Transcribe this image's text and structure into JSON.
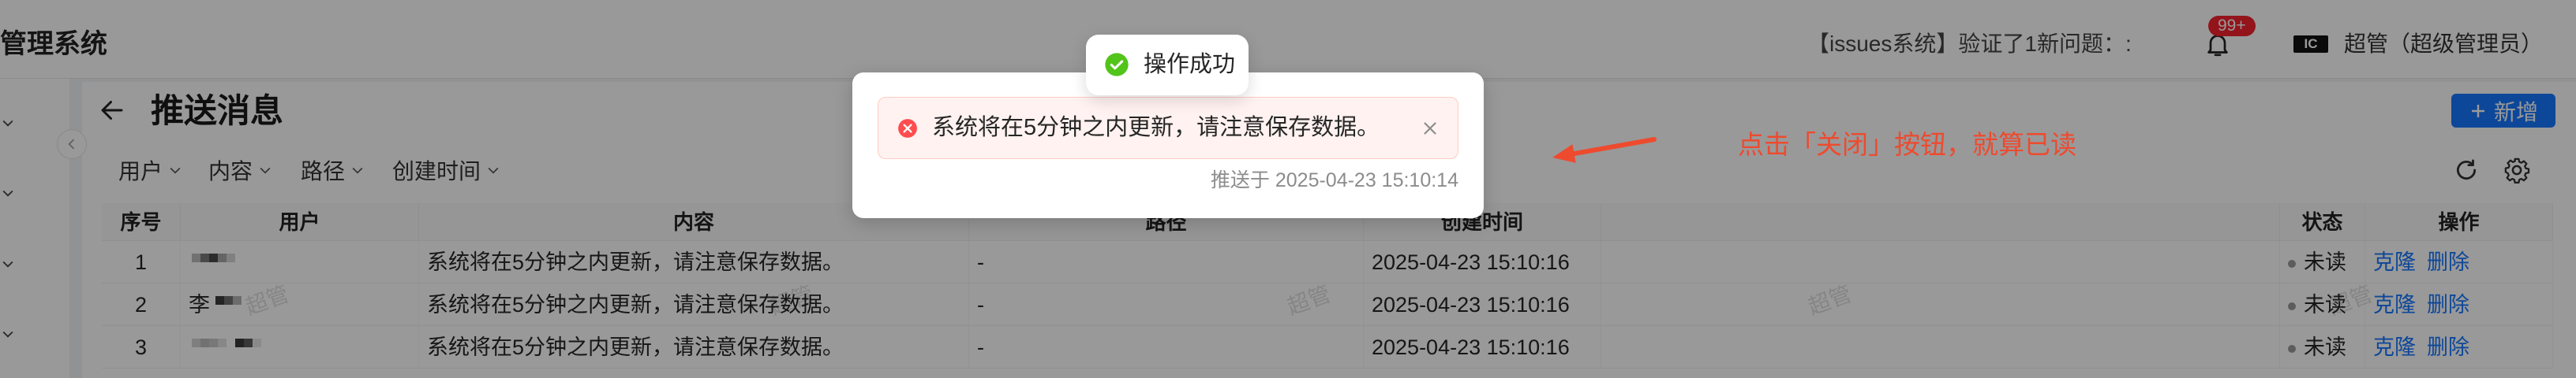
{
  "header": {
    "app_title": "管理系统",
    "notice": "【issues系统】验证了1新问题：:",
    "notification_icon": "bell-icon",
    "badge": "99+",
    "logo_text": "IC",
    "user_name": "超管（超级管理员）"
  },
  "page": {
    "title": "推送消息",
    "add_button": "新增"
  },
  "filters": [
    "用户",
    "内容",
    "路径",
    "创建时间"
  ],
  "table": {
    "columns": [
      "序号",
      "用户",
      "内容",
      "路径",
      "创建时间",
      "状态",
      "操作"
    ],
    "rows": [
      {
        "index": "1",
        "content": "系统将在5分钟之内更新，请注意保存数据。",
        "path": "-",
        "created_at": "2025-04-23 15:10:16",
        "status": "未读",
        "actions": [
          "克隆",
          "删除"
        ]
      },
      {
        "index": "2",
        "user": "李",
        "content": "系统将在5分钟之内更新，请注意保存数据。",
        "path": "-",
        "created_at": "2025-04-23 15:10:16",
        "status": "未读",
        "actions": [
          "克隆",
          "删除"
        ]
      },
      {
        "index": "3",
        "content": "系统将在5分钟之内更新，请注意保存数据。",
        "path": "-",
        "created_at": "2025-04-23 15:10:16",
        "status": "未读",
        "actions": [
          "克隆",
          "删除"
        ]
      }
    ]
  },
  "watermark": "超管",
  "toast": {
    "text": "操作成功",
    "icon": "check-circle-icon"
  },
  "message_modal": {
    "content": "系统将在5分钟之内更新，请注意保存数据。",
    "pushed_at": "推送于 2025-04-23 15:10:14",
    "icon": "error-circle-icon"
  },
  "annotation": {
    "text": "点击「关闭」按钮，就算已读"
  },
  "colors": {
    "primary": "#1677ff",
    "danger": "#ff4d4f",
    "success": "#52c41a",
    "badge": "#f5222d",
    "annotation": "#ee4a2e"
  }
}
